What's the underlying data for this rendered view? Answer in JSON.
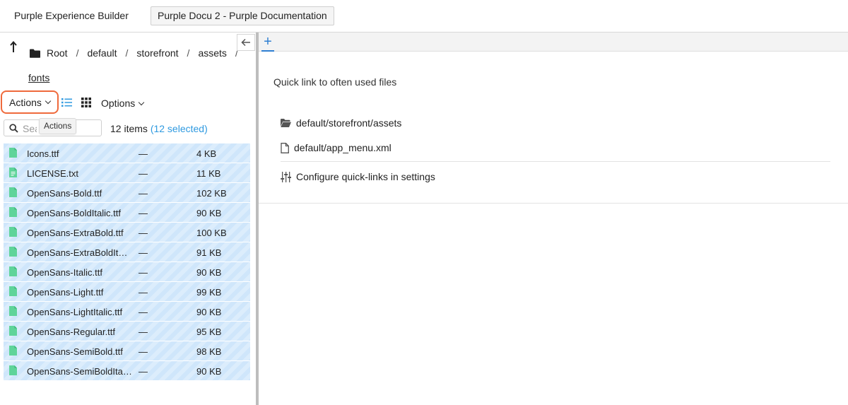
{
  "topbar": {
    "app_title": "Purple Experience Builder",
    "doc_tab": "Purple Docu 2 - Purple Documentation"
  },
  "breadcrumb": {
    "items": [
      "Root",
      "default",
      "storefront",
      "assets"
    ],
    "separator": "/",
    "current": "fonts"
  },
  "toolbar": {
    "actions_label": "Actions",
    "options_label": "Options",
    "tooltip": "Actions"
  },
  "search": {
    "placeholder": "Search"
  },
  "status": {
    "items": "12 items",
    "selected": "(12 selected)"
  },
  "columns": [
    "name",
    "date",
    "size"
  ],
  "files": [
    {
      "name": "Icons.ttf",
      "date": "—",
      "size": "4 KB"
    },
    {
      "name": "LICENSE.txt",
      "date": "—",
      "size": "11 KB"
    },
    {
      "name": "OpenSans-Bold.ttf",
      "date": "—",
      "size": "102 KB"
    },
    {
      "name": "OpenSans-BoldItalic.ttf",
      "date": "—",
      "size": "90 KB"
    },
    {
      "name": "OpenSans-ExtraBold.ttf",
      "date": "—",
      "size": "100 KB"
    },
    {
      "name": "OpenSans-ExtraBoldIt…",
      "date": "—",
      "size": "91 KB"
    },
    {
      "name": "OpenSans-Italic.ttf",
      "date": "—",
      "size": "90 KB"
    },
    {
      "name": "OpenSans-Light.ttf",
      "date": "—",
      "size": "99 KB"
    },
    {
      "name": "OpenSans-LightItalic.ttf",
      "date": "—",
      "size": "90 KB"
    },
    {
      "name": "OpenSans-Regular.ttf",
      "date": "—",
      "size": "95 KB"
    },
    {
      "name": "OpenSans-SemiBold.ttf",
      "date": "—",
      "size": "98 KB"
    },
    {
      "name": "OpenSans-SemiBoldIta…",
      "date": "—",
      "size": "90 KB"
    }
  ],
  "right": {
    "tab_plus": "+",
    "quick_title": "Quick link to often used files",
    "links": [
      {
        "label": "default/storefront/assets",
        "icon": "folder-open-icon"
      },
      {
        "label": "default/app_menu.xml",
        "icon": "file-icon"
      }
    ],
    "configure_label": "Configure quick-links in settings"
  },
  "colors": {
    "accent": "#2f9ae0",
    "highlight_outline": "#ef6a3c",
    "selection_row": "#cfe6fb",
    "file_icon": "#5fd49a"
  }
}
